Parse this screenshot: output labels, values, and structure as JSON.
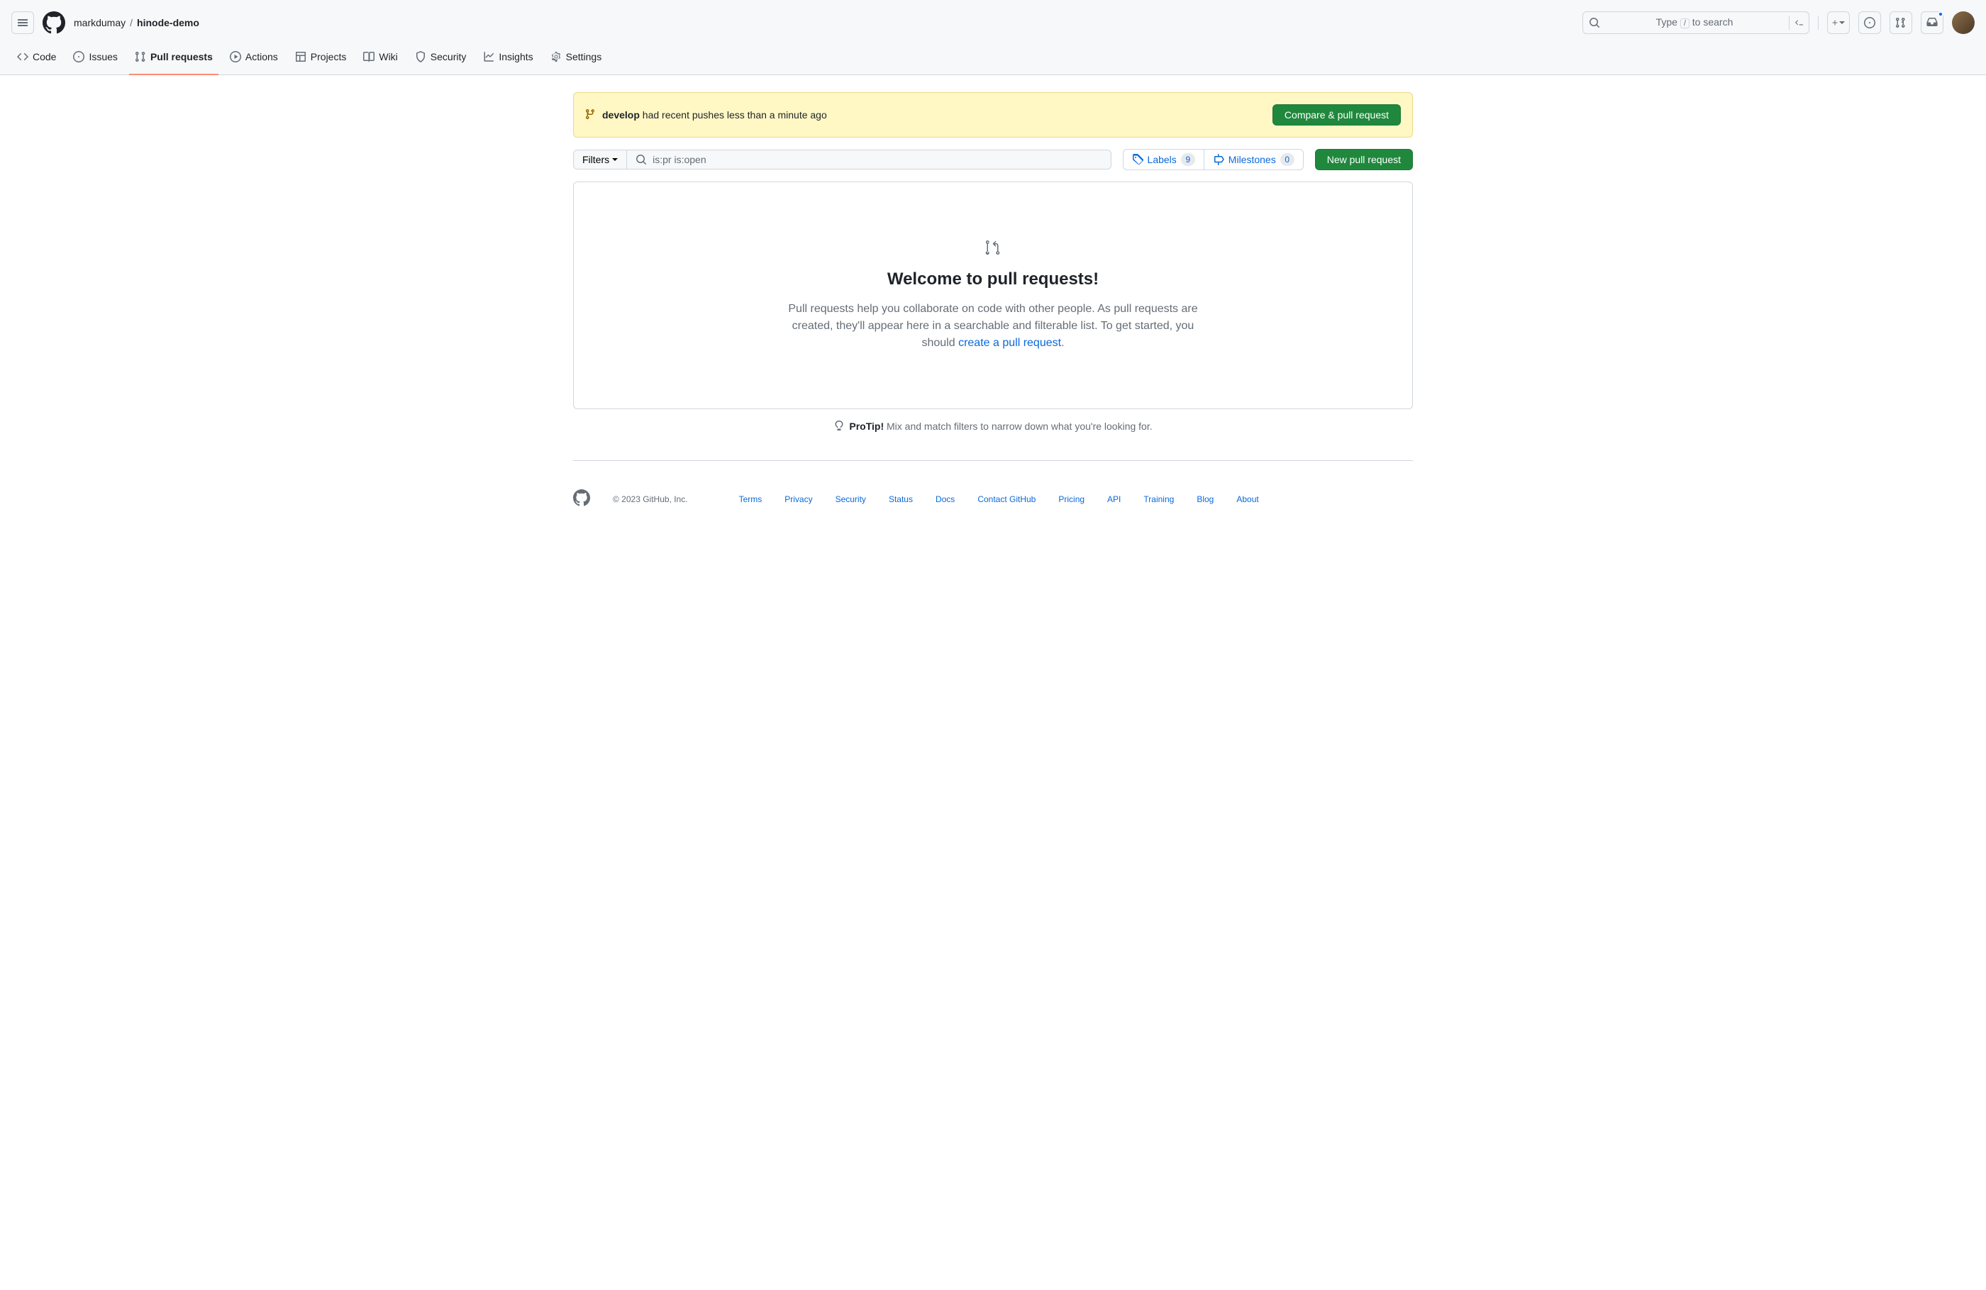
{
  "breadcrumb": {
    "owner": "markdumay",
    "repo": "hinode-demo"
  },
  "search": {
    "prefix": "Type",
    "key": "/",
    "suffix": "to search"
  },
  "nav": {
    "code": "Code",
    "issues": "Issues",
    "pulls": "Pull requests",
    "actions": "Actions",
    "projects": "Projects",
    "wiki": "Wiki",
    "security": "Security",
    "insights": "Insights",
    "settings": "Settings"
  },
  "notice": {
    "branch": "develop",
    "text": " had recent pushes less than a minute ago",
    "button": "Compare & pull request"
  },
  "filter": {
    "label": "Filters",
    "query": "is:pr is:open",
    "labels": "Labels",
    "labels_count": "9",
    "milestones": "Milestones",
    "milestones_count": "0",
    "new_pr": "New pull request"
  },
  "empty": {
    "title": "Welcome to pull requests!",
    "body_pre": "Pull requests help you collaborate on code with other people. As pull requests are created, they'll appear here in a searchable and filterable list. To get started, you should ",
    "link": "create a pull request",
    "body_post": "."
  },
  "protip": {
    "label": "ProTip!",
    "text": "Mix and match filters to narrow down what you're looking for."
  },
  "footer": {
    "copyright": "© 2023 GitHub, Inc.",
    "links": [
      "Terms",
      "Privacy",
      "Security",
      "Status",
      "Docs",
      "Contact GitHub",
      "Pricing",
      "API",
      "Training",
      "Blog",
      "About"
    ]
  }
}
